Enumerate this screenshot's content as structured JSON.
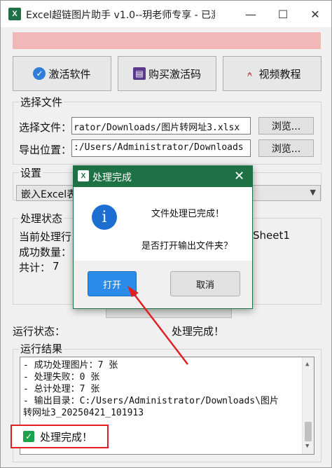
{
  "window": {
    "title": "Excel超链图片助手 v1.0--玥老师专享 - 已激...",
    "app_icon_letter": "X"
  },
  "toolbar": {
    "activate_label": "激活软件",
    "buy_label": "购买激活码",
    "video_label": "视频教程"
  },
  "file_section": {
    "label": "选择文件",
    "select_label": "选择文件：",
    "select_value": "rator/Downloads/图片转网址3.xlsx",
    "export_label": "导出位置：",
    "export_value": ":/Users/Administrator/Downloads",
    "browse_label": "浏览..."
  },
  "settings": {
    "label": "设置",
    "embed_value": "嵌入Excel表"
  },
  "status_section": {
    "label": "处理状态",
    "current_label": "当前处理行",
    "current_sheet": "Sheet1",
    "success_label": "成功数量：",
    "total_label": "共计：",
    "total_value": "7"
  },
  "run_status": {
    "label": "运行状态：",
    "value": "处理完成！"
  },
  "results": {
    "label": "运行结果",
    "lines": [
      "- 成功处理图片：7 张",
      "- 处理失败：0 张",
      "- 总计处理：7 张",
      "- 输出目录：C:/Users/Administrator/Downloads\\图片",
      "转网址3_20250421_101913"
    ],
    "done_text": "处理完成！"
  },
  "dialog": {
    "title": "处理完成",
    "message1": "文件处理已完成！",
    "message2": "是否打开输出文件夹？",
    "ok_label": "打开",
    "cancel_label": "取消",
    "info_glyph": "i"
  },
  "colors": {
    "excel_green": "#1e7145",
    "highlight_red": "#e02020",
    "primary_blue": "#2a8ce8"
  }
}
